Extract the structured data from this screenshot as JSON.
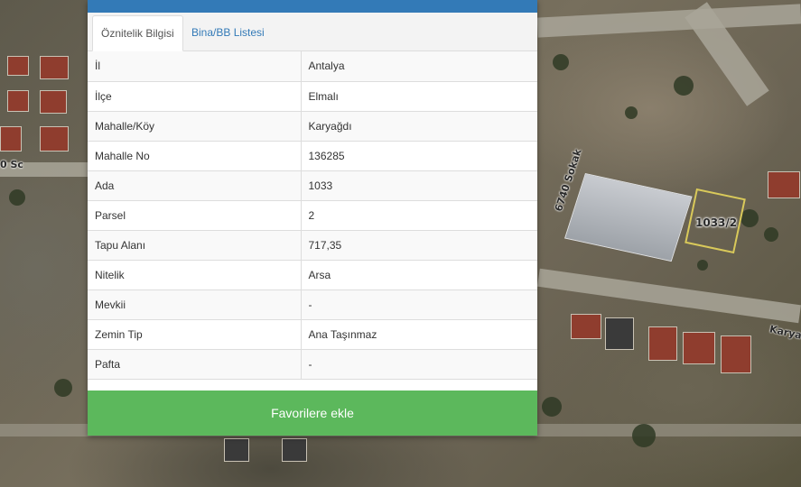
{
  "tabs": {
    "attributes": "Öznitelik Bilgisi",
    "buildings": "Bina/BB Listesi"
  },
  "rows": [
    {
      "key": "İl",
      "value": "Antalya"
    },
    {
      "key": "İlçe",
      "value": "Elmalı"
    },
    {
      "key": "Mahalle/Köy",
      "value": "Karyağdı"
    },
    {
      "key": "Mahalle No",
      "value": "136285"
    },
    {
      "key": "Ada",
      "value": "1033"
    },
    {
      "key": "Parsel",
      "value": "2"
    },
    {
      "key": "Tapu Alanı",
      "value": "717,35"
    },
    {
      "key": "Nitelik",
      "value": "Arsa"
    },
    {
      "key": "Mevkii",
      "value": "-"
    },
    {
      "key": "Zemin Tip",
      "value": "Ana Taşınmaz"
    },
    {
      "key": "Pafta",
      "value": "-"
    }
  ],
  "favorite_button": "Favorilere ekle",
  "map": {
    "parcel_label": "1033/2",
    "street_label_1": "6740 Sokak",
    "street_label_2": "Karya",
    "street_label_3": "0 Sc"
  },
  "colors": {
    "header": "#337ab7",
    "link": "#337ab7",
    "button": "#5cb85c"
  }
}
